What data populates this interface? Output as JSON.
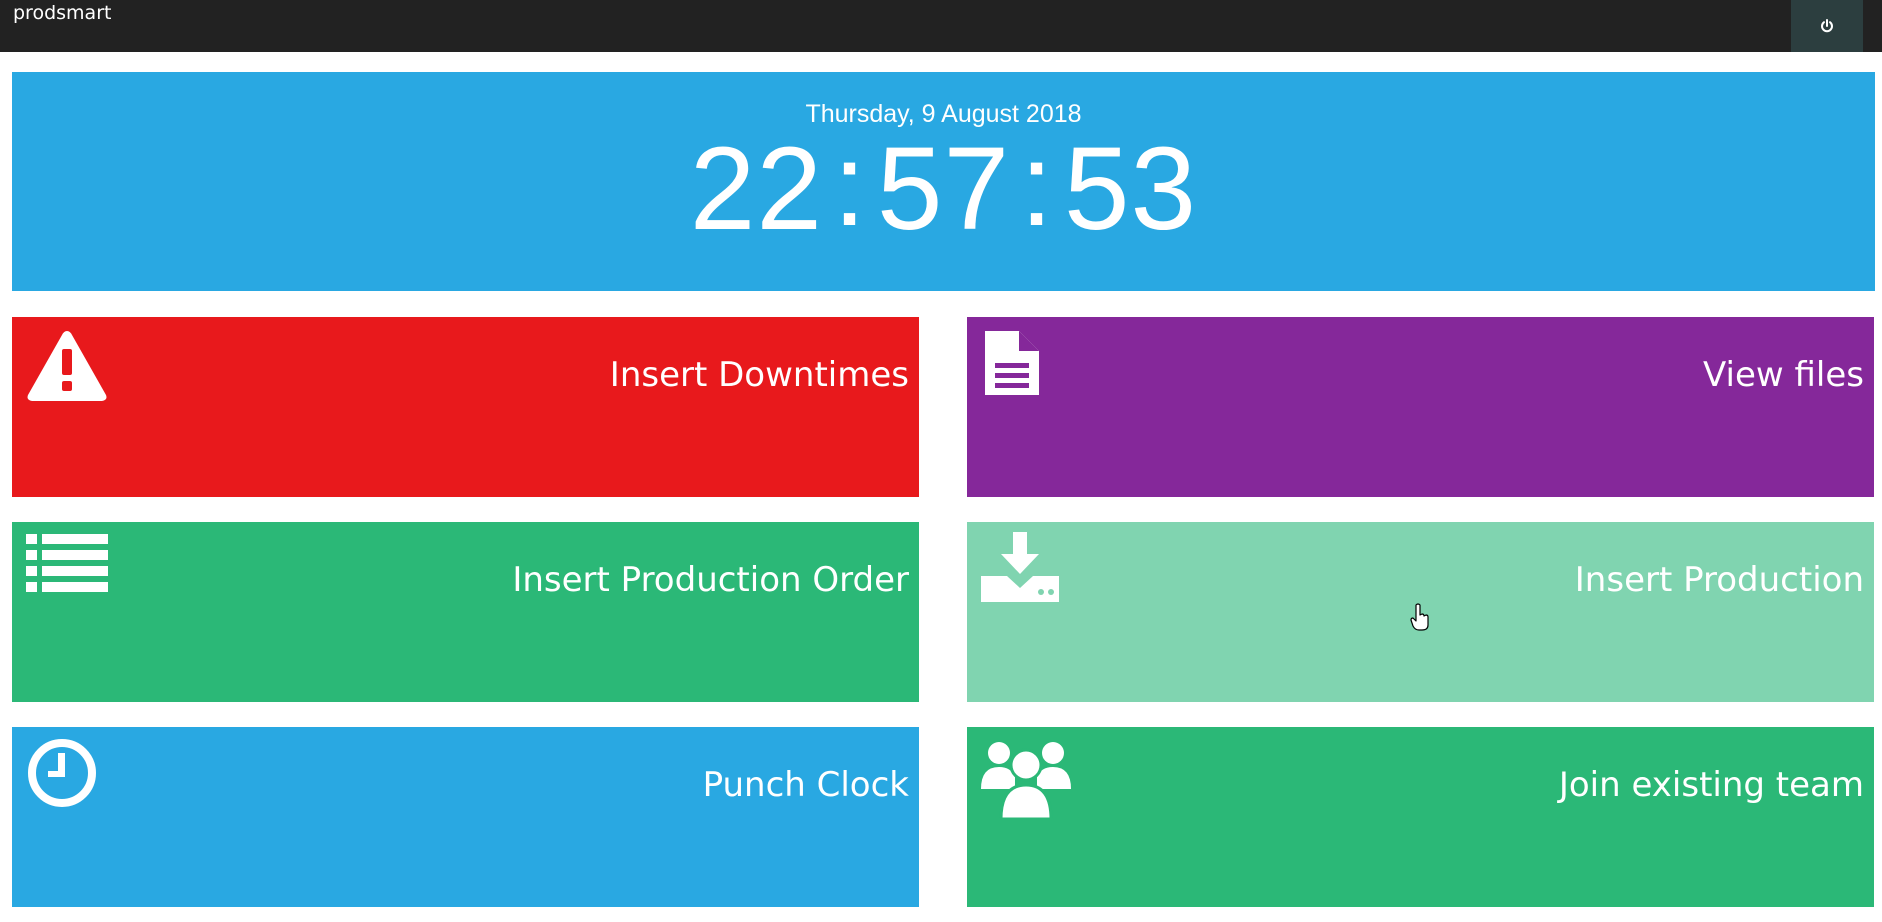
{
  "app": {
    "brand": "prodsmart"
  },
  "header": {
    "power_icon": "power-icon"
  },
  "clock": {
    "date": "Thursday, 9 August 2018",
    "hours": "22",
    "minutes": "57",
    "seconds": "53",
    "separator": ":"
  },
  "tiles": [
    {
      "label": "Insert Downtimes",
      "icon": "warning-icon",
      "color": "#e8191c"
    },
    {
      "label": "View files",
      "icon": "file-icon",
      "color": "#85289a"
    },
    {
      "label": "Insert Production Order",
      "icon": "list-icon",
      "color": "#2bb877"
    },
    {
      "label": "Insert Production",
      "icon": "download-icon",
      "color": "#80d4b0"
    },
    {
      "label": "Punch Clock",
      "icon": "clock-icon",
      "color": "#29a8e2"
    },
    {
      "label": "Join existing team",
      "icon": "users-icon",
      "color": "#2bb877"
    }
  ],
  "colors": {
    "topbar": "#222222",
    "power_button": "#2c3e3f",
    "clock_panel": "#29a8e2"
  }
}
